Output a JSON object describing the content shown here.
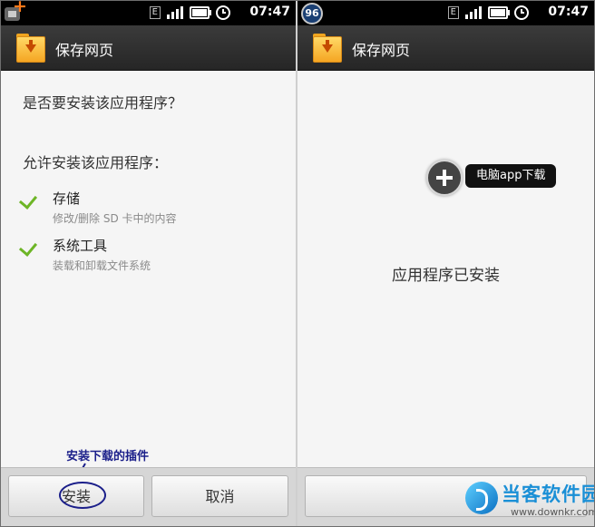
{
  "status_bar": {
    "time": "07:47",
    "network": "E",
    "badge_count": "96"
  },
  "app_title": "保存网页",
  "left_screen": {
    "question": "是否要安装该应用程序？",
    "permissions_heading": "允许安装该应用程序：",
    "permissions": [
      {
        "name": "存储",
        "desc": "修改/删除 SD 卡中的内容"
      },
      {
        "name": "系统工具",
        "desc": "装载和卸载文件系统"
      }
    ],
    "annotation": "安装下载的插件",
    "install_label": "安装",
    "cancel_label": "取消"
  },
  "right_screen": {
    "installed_text": "应用程序已安装",
    "float_label": "电脑app下载"
  },
  "watermark": {
    "title": "当客软件园",
    "url": "www.downkr.com"
  },
  "colors": {
    "check": "#6db526",
    "annotation": "#1b1f8a",
    "watermark": "#1a8fd6"
  }
}
